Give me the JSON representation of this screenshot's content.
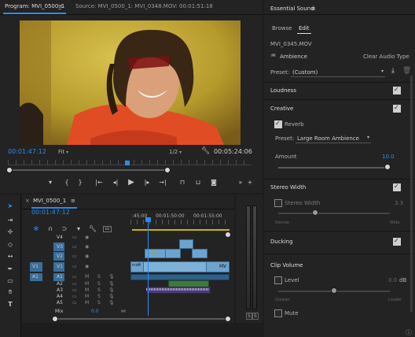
{
  "program": {
    "tab_label": "Program: MVI_0500_1",
    "tab_menu_icon": "hamburger-icon",
    "source_tab_label": "Source: MVI_0500_1: MVI_0348.MOV: 00:01:51:18",
    "timecode_current": "00:01:47:12",
    "fit_label": "Fit",
    "resolution_label": "1/2",
    "timecode_duration": "00:05:24:06",
    "playback_progress": 0.49
  },
  "timeline": {
    "tab_label": "MVI_0500_1",
    "timecode": "00:01:47:12",
    "ruler_labels": [
      ":45:00",
      "00:01:50:00",
      "00:01:55:00"
    ],
    "video_tracks": [
      "V4",
      "V3",
      "V2",
      "V1"
    ],
    "audio_tracks": [
      "A1",
      "A2",
      "A3",
      "A4",
      "A5"
    ],
    "source_patch_v": "V1",
    "source_patch_a": "A1",
    "mix_label": "Mix",
    "mix_value": "0.0",
    "track_m": "M",
    "track_s": "S",
    "clip_labels": [
      "MV",
      "rcd4"
    ]
  },
  "meters": {
    "solo_left": "S",
    "solo_right": "S"
  },
  "essential_sound": {
    "title": "Essential Sound",
    "tab_browse": "Browse",
    "tab_edit": "Edit",
    "clip_name": "MVI_0345.MOV",
    "type_label": "Ambience",
    "clear_button": "Clear Audio Type",
    "preset_label": "Preset:",
    "preset_value": "(Custom)",
    "loudness_label": "Loudness",
    "loudness_checked": true,
    "creative_label": "Creative",
    "creative_checked": true,
    "reverb_label": "Reverb",
    "reverb_checked": true,
    "reverb_preset_label": "Preset:",
    "reverb_preset_value": "Large Room Ambience",
    "amount_label": "Amount",
    "amount_value": "10.0",
    "amount_fraction": 0.98,
    "stereo_width_label": "Stereo Width",
    "stereo_width_checked": true,
    "stereo_width_sub_label": "Stereo Width",
    "stereo_width_sub_checked": false,
    "stereo_width_value": "3.3",
    "stereo_width_fraction": 0.33,
    "narrow_label": "Narrow",
    "wide_label": "Wide",
    "ducking_label": "Ducking",
    "ducking_checked": true,
    "clip_volume_label": "Clip Volume",
    "level_label": "Level",
    "level_checked": false,
    "level_value": "0.0",
    "level_unit": "dB",
    "level_fraction": 0.5,
    "quieter_label": "Quieter",
    "louder_label": "Louder",
    "mute_label": "Mute",
    "mute_checked": false
  },
  "colors": {
    "accent": "#2d8ceb",
    "video_clip": "#6da3cf",
    "audio_clip": "#3c7a3a",
    "playhead": "#2d8ceb"
  }
}
